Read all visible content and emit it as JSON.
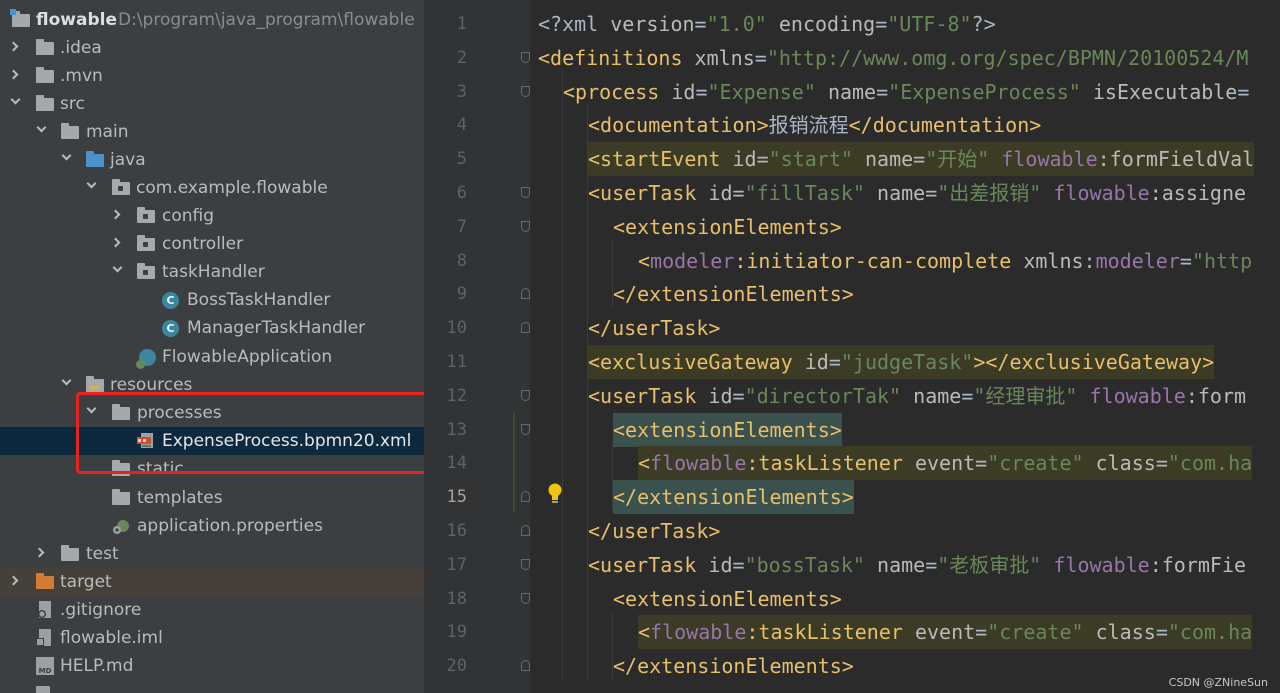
{
  "project": {
    "root_name": "flowable",
    "root_path": "D:\\program\\java_program\\flowable",
    "items": [
      {
        "label": ".idea"
      },
      {
        "label": ".mvn"
      },
      {
        "label": "src"
      },
      {
        "label": "main"
      },
      {
        "label": "java"
      },
      {
        "label": "com.example.flowable"
      },
      {
        "label": "config"
      },
      {
        "label": "controller"
      },
      {
        "label": "taskHandler"
      },
      {
        "label": "BossTaskHandler"
      },
      {
        "label": "ManagerTaskHandler"
      },
      {
        "label": "FlowableApplication"
      },
      {
        "label": "resources"
      },
      {
        "label": "processes"
      },
      {
        "label": "ExpenseProcess.bpmn20.xml"
      },
      {
        "label": "static"
      },
      {
        "label": "templates"
      },
      {
        "label": "application.properties"
      },
      {
        "label": "test"
      },
      {
        "label": "target"
      },
      {
        "label": ".gitignore"
      },
      {
        "label": "flowable.iml"
      },
      {
        "label": "HELP.md"
      }
    ],
    "class_icon_letter": "C",
    "md_icon_text": "MD"
  },
  "editor": {
    "line_numbers": [
      "1",
      "2",
      "3",
      "4",
      "5",
      "6",
      "7",
      "8",
      "9",
      "10",
      "11",
      "12",
      "13",
      "14",
      "15",
      "16",
      "17",
      "18",
      "19",
      "20"
    ],
    "current_line": "15",
    "lines": [
      [
        {
          "t": "<?xml ",
          "c": "txt"
        },
        {
          "t": "version",
          "c": "attr"
        },
        {
          "t": "=",
          "c": "txt"
        },
        {
          "t": "\"1.0\"",
          "c": "val"
        },
        {
          "t": " ",
          "c": "txt"
        },
        {
          "t": "encoding",
          "c": "attr"
        },
        {
          "t": "=",
          "c": "txt"
        },
        {
          "t": "\"UTF-8\"",
          "c": "val"
        },
        {
          "t": "?>",
          "c": "txt"
        }
      ],
      [
        {
          "t": "<definitions ",
          "c": "tag"
        },
        {
          "t": "xmlns",
          "c": "attr"
        },
        {
          "t": "=",
          "c": "txt"
        },
        {
          "t": "\"http://www.omg.org/spec/BPMN/20100524/M",
          "c": "val"
        }
      ],
      [
        {
          "t": "<process ",
          "c": "tag"
        },
        {
          "t": "id",
          "c": "attr"
        },
        {
          "t": "=",
          "c": "txt"
        },
        {
          "t": "\"Expense\"",
          "c": "val"
        },
        {
          "t": " ",
          "c": "txt"
        },
        {
          "t": "name",
          "c": "attr"
        },
        {
          "t": "=",
          "c": "txt"
        },
        {
          "t": "\"ExpenseProcess\"",
          "c": "val"
        },
        {
          "t": " ",
          "c": "txt"
        },
        {
          "t": "isExecutable",
          "c": "attr"
        },
        {
          "t": "=",
          "c": "txt"
        }
      ],
      [
        {
          "t": "<documentation>",
          "c": "tag"
        },
        {
          "t": "报销流程",
          "c": "txt"
        },
        {
          "t": "</documentation>",
          "c": "tag"
        }
      ],
      [
        {
          "t": "<startEvent ",
          "c": "tag",
          "h": "hl-yellow"
        },
        {
          "t": "id",
          "c": "attr"
        },
        {
          "t": "=",
          "c": "txt"
        },
        {
          "t": "\"start\"",
          "c": "val"
        },
        {
          "t": " ",
          "c": "txt"
        },
        {
          "t": "name",
          "c": "attr"
        },
        {
          "t": "=",
          "c": "txt"
        },
        {
          "t": "\"开始\"",
          "c": "val"
        },
        {
          "t": " ",
          "c": "txt"
        },
        {
          "t": "flowable",
          "c": "ns"
        },
        {
          "t": ":formFieldVal",
          "c": "attr"
        }
      ],
      [
        {
          "t": "<userTask ",
          "c": "tag"
        },
        {
          "t": "id",
          "c": "attr"
        },
        {
          "t": "=",
          "c": "txt"
        },
        {
          "t": "\"fillTask\"",
          "c": "val"
        },
        {
          "t": " ",
          "c": "txt"
        },
        {
          "t": "name",
          "c": "attr"
        },
        {
          "t": "=",
          "c": "txt"
        },
        {
          "t": "\"出差报销\"",
          "c": "val"
        },
        {
          "t": " ",
          "c": "txt"
        },
        {
          "t": "flowable",
          "c": "ns"
        },
        {
          "t": ":assigne",
          "c": "attr"
        }
      ],
      [
        {
          "t": "<extensionElements>",
          "c": "tag"
        }
      ],
      [
        {
          "t": "<",
          "c": "tag"
        },
        {
          "t": "modeler",
          "c": "ns"
        },
        {
          "t": ":initiator-can-complete ",
          "c": "tag"
        },
        {
          "t": "xmlns",
          "c": "attr"
        },
        {
          "t": ":",
          "c": "txt"
        },
        {
          "t": "modeler",
          "c": "ns"
        },
        {
          "t": "=",
          "c": "txt"
        },
        {
          "t": "\"http",
          "c": "val"
        }
      ],
      [
        {
          "t": "</extensionElements>",
          "c": "tag"
        }
      ],
      [
        {
          "t": "</userTask>",
          "c": "tag"
        }
      ],
      [
        {
          "t": "<exclusiveGateway ",
          "c": "tag",
          "h": "hl-yellow"
        },
        {
          "t": "id",
          "c": "attr"
        },
        {
          "t": "=",
          "c": "txt"
        },
        {
          "t": "\"judgeTask\"",
          "c": "val"
        },
        {
          "t": "></exclusiveGateway>",
          "c": "tag"
        }
      ],
      [
        {
          "t": "<userTask ",
          "c": "tag"
        },
        {
          "t": "id",
          "c": "attr"
        },
        {
          "t": "=",
          "c": "txt"
        },
        {
          "t": "\"directorTak\"",
          "c": "val"
        },
        {
          "t": " ",
          "c": "txt"
        },
        {
          "t": "name",
          "c": "attr"
        },
        {
          "t": "=",
          "c": "txt"
        },
        {
          "t": "\"经理审批\"",
          "c": "val"
        },
        {
          "t": " ",
          "c": "txt"
        },
        {
          "t": "flowable",
          "c": "ns"
        },
        {
          "t": ":form",
          "c": "attr"
        }
      ],
      [
        {
          "t": "<extensionElements>",
          "c": "tag",
          "h": "hl-match"
        }
      ],
      [
        {
          "t": "<",
          "c": "tag",
          "h": "hl-yellow"
        },
        {
          "t": "flowable",
          "c": "ns"
        },
        {
          "t": ":taskListener ",
          "c": "tag"
        },
        {
          "t": "event",
          "c": "attr"
        },
        {
          "t": "=",
          "c": "txt"
        },
        {
          "t": "\"create\"",
          "c": "val"
        },
        {
          "t": " ",
          "c": "txt"
        },
        {
          "t": "class",
          "c": "attr"
        },
        {
          "t": "=",
          "c": "txt"
        },
        {
          "t": "\"com.ha",
          "c": "val"
        }
      ],
      [
        {
          "t": "</extensionElements>",
          "c": "tag",
          "h": "hl-match"
        }
      ],
      [
        {
          "t": "</userTask>",
          "c": "tag"
        }
      ],
      [
        {
          "t": "<userTask ",
          "c": "tag"
        },
        {
          "t": "id",
          "c": "attr"
        },
        {
          "t": "=",
          "c": "txt"
        },
        {
          "t": "\"bossTask\"",
          "c": "val"
        },
        {
          "t": " ",
          "c": "txt"
        },
        {
          "t": "name",
          "c": "attr"
        },
        {
          "t": "=",
          "c": "txt"
        },
        {
          "t": "\"老板审批\"",
          "c": "val"
        },
        {
          "t": " ",
          "c": "txt"
        },
        {
          "t": "flowable",
          "c": "ns"
        },
        {
          "t": ":formFie",
          "c": "attr"
        }
      ],
      [
        {
          "t": "<extensionElements>",
          "c": "tag"
        }
      ],
      [
        {
          "t": "<",
          "c": "tag",
          "h": "hl-yellow"
        },
        {
          "t": "flowable",
          "c": "ns"
        },
        {
          "t": ":taskListener ",
          "c": "tag"
        },
        {
          "t": "event",
          "c": "attr"
        },
        {
          "t": "=",
          "c": "txt"
        },
        {
          "t": "\"create\"",
          "c": "val"
        },
        {
          "t": " ",
          "c": "txt"
        },
        {
          "t": "class",
          "c": "attr"
        },
        {
          "t": "=",
          "c": "txt"
        },
        {
          "t": "\"com.ha",
          "c": "val"
        }
      ],
      [
        {
          "t": "</extensionElements>",
          "c": "tag"
        }
      ]
    ]
  },
  "watermark": "CSDN @ZNineSun",
  "colors": {
    "tag": "#e8bf6a",
    "attribute": "#bababa",
    "value": "#6a8759",
    "namespace": "#9876aa",
    "highlight_box": "#e8221f"
  }
}
